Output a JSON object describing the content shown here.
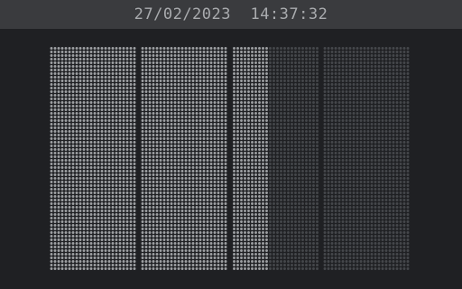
{
  "header": {
    "datetime": "27/02/2023  14:37:32"
  },
  "display": {
    "columns": 4,
    "column_fill_fraction": [
      1.0,
      1.0,
      0.4,
      0.0
    ],
    "colors": {
      "background": "#1f2023",
      "topbar": "#3a3b3e",
      "dot_lit": "#9ea0a3",
      "dot_unlit": "#45474b",
      "text": "#a9abae"
    }
  }
}
